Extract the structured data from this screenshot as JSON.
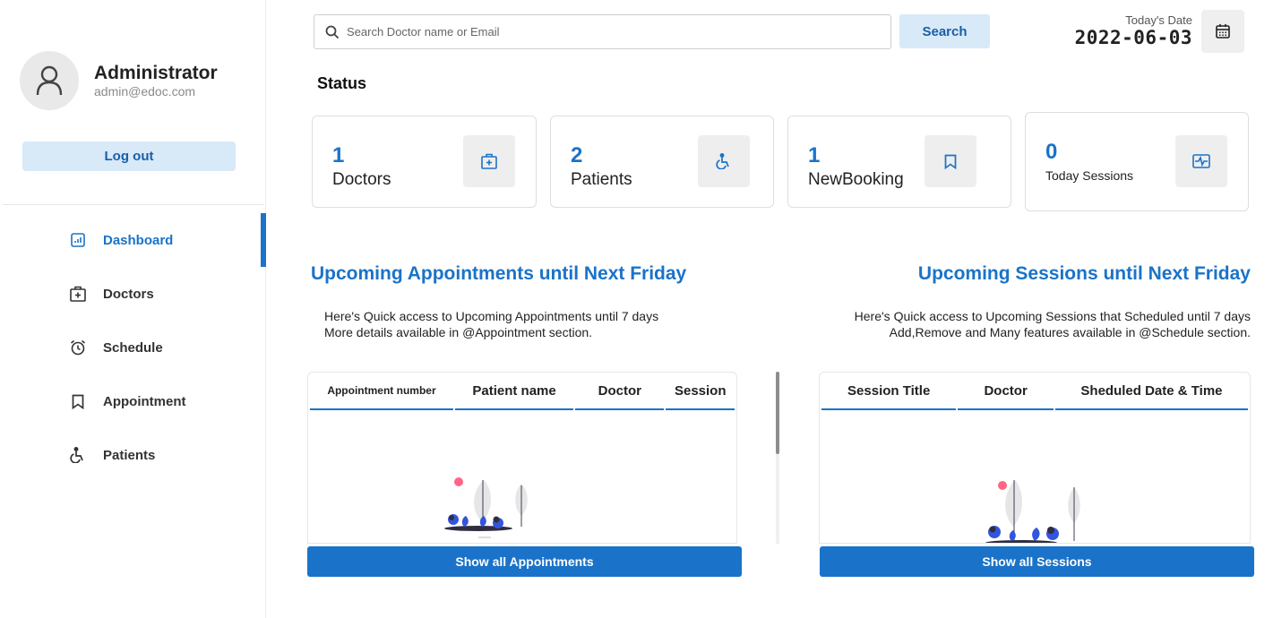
{
  "profile": {
    "name": "Administrator",
    "email": "admin@edoc.com"
  },
  "logout_label": "Log out",
  "menu": [
    {
      "label": "Dashboard",
      "icon": "dashboard-icon",
      "active": true
    },
    {
      "label": "Doctors",
      "icon": "doctors-icon",
      "active": false
    },
    {
      "label": "Schedule",
      "icon": "alarm-clock-icon",
      "active": false
    },
    {
      "label": "Appointment",
      "icon": "bookmark-icon",
      "active": false
    },
    {
      "label": "Patients",
      "icon": "wheelchair-icon",
      "active": false
    }
  ],
  "search": {
    "placeholder": "Search Doctor name or Email",
    "button_label": "Search"
  },
  "date": {
    "label": "Today's Date",
    "value": "2022-06-03"
  },
  "status": {
    "title": "Status",
    "cards": [
      {
        "value": "1",
        "label": "Doctors",
        "icon": "medical-kit-icon"
      },
      {
        "value": "2",
        "label": "Patients",
        "icon": "wheelchair-icon"
      },
      {
        "value": "1",
        "label": "NewBooking",
        "icon": "bookmark-icon"
      },
      {
        "value": "0",
        "label": "Today Sessions",
        "icon": "sessions-icon"
      }
    ]
  },
  "appointments": {
    "title": "Upcoming Appointments until Next Friday",
    "desc_line1": "Here's Quick access to Upcoming Appointments until 7 days",
    "desc_line2": "More details available in @Appointment section.",
    "columns": [
      "Appointment number",
      "Patient name",
      "Doctor",
      "Session"
    ],
    "button_label": "Show all Appointments"
  },
  "sessions": {
    "title": "Upcoming Sessions until Next Friday",
    "desc_line1": "Here's Quick access to Upcoming Sessions that Scheduled until 7 days",
    "desc_line2": "Add,Remove and Many features available in @Schedule section.",
    "columns": [
      "Session Title",
      "Doctor",
      "Sheduled Date & Time"
    ],
    "button_label": "Show all Sessions"
  },
  "colors": {
    "accent": "#1a73c8",
    "soft_button": "#d8e9f8",
    "icon_bg": "#eeeeee"
  }
}
